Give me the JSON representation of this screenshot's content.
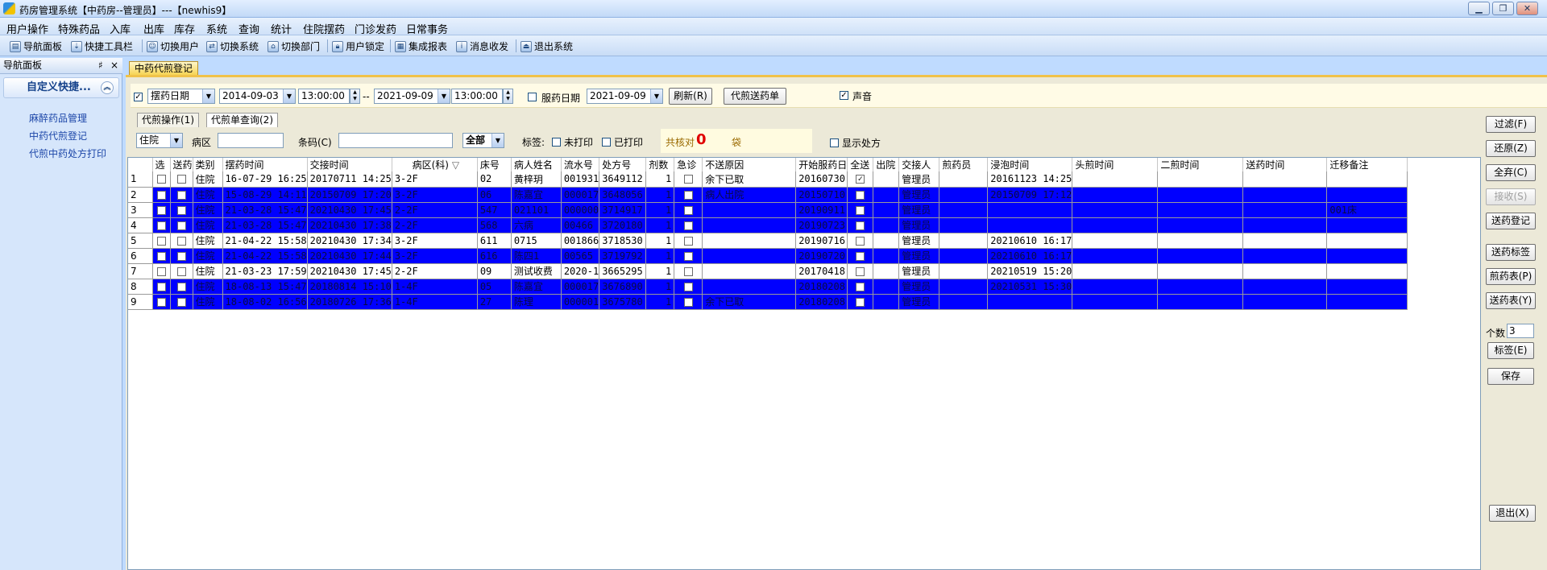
{
  "window": {
    "title": "药房管理系统【中药房--管理员】---【newhis9】"
  },
  "menu": [
    "用户操作",
    "特殊药品",
    "入库",
    "出库",
    "库存",
    "系统",
    "查询",
    "统计",
    "住院摆药",
    "门诊发药",
    "日常事务"
  ],
  "toolbar": [
    "导航面板",
    "快捷工具栏",
    "切换用户",
    "切换系统",
    "切换部门",
    "用户锁定",
    "集成报表",
    "消息收发",
    "退出系统"
  ],
  "nav": {
    "header": "导航面板",
    "pin": "♯",
    "close": "×",
    "group": "自定义快捷...",
    "items": [
      "麻醉药品管理",
      "中药代煎登记",
      "代煎中药处方打印"
    ]
  },
  "doc_tab": "中药代煎登记",
  "filter": {
    "date_type": "摆药日期",
    "start_date": "2014-09-03",
    "start_time": "13:00:00",
    "dash": "--",
    "end_date": "2021-09-09",
    "end_time": "13:00:00",
    "take_date_label": "服药日期",
    "take_date": "2021-09-09",
    "refresh_btn": "刷新(R)",
    "send_btn": "代煎送药单",
    "sound_label": "声音"
  },
  "subtabs": [
    "代煎操作(1)",
    "代煎单查询(2)"
  ],
  "query": {
    "type": "住院",
    "ward_label": "病区",
    "barcode_label": "条码(C)",
    "all": "全部",
    "tag_label": "标签:",
    "unprinted": "未打印",
    "printed": "已打印",
    "count_label": "共核对",
    "count_value": "0",
    "bag_label": "袋",
    "show_rx": "显示处方"
  },
  "grid": {
    "headers": [
      "选",
      "送药",
      "类别",
      "摆药时间",
      "交接时间",
      "病区(科)",
      "床号",
      "病人姓名",
      "流水号",
      "处方号",
      "剂数",
      "急诊",
      "不送原因",
      "开始服药日",
      "全送",
      "出院",
      "交接人",
      "煎药员",
      "浸泡时间",
      "头煎时间",
      "二煎时间",
      "送药时间",
      "迁移备注"
    ],
    "rows": [
      {
        "n": "1",
        "sel": false,
        "type": "住院",
        "disp": "16-07-29 16:25",
        "hand": "20170711 14:25",
        "ward": "3-2F",
        "bed": "02",
        "name": "黄梓玥",
        "serial": "001931",
        "rx": "3649112",
        "qty": "1",
        "reason": "余下已取",
        "start": "20160730",
        "allsend": true,
        "handler": "管理员",
        "soak": "20161123 14:25",
        "note": ""
      },
      {
        "n": "2",
        "sel": true,
        "type": "住院",
        "disp": "15-08-29 14:11",
        "hand": "20150709 17:20",
        "ward": "3-2F",
        "bed": "06",
        "name": "陈嘉宜",
        "serial": "000017",
        "rx": "3648056",
        "qty": "1",
        "reason": "病人出院",
        "start": "20150710",
        "allsend": false,
        "handler": "管理员",
        "soak": "20150709 17:12",
        "note": ""
      },
      {
        "n": "3",
        "sel": true,
        "type": "住院",
        "disp": "21-03-28 15:47",
        "hand": "20210430 17:45",
        "ward": "2-2F",
        "bed": "547",
        "name": "021101",
        "serial": "000000",
        "rx": "3714917",
        "qty": "1",
        "reason": "",
        "start": "20190911",
        "allsend": false,
        "handler": "管理员",
        "soak": "",
        "note": "001床"
      },
      {
        "n": "4",
        "sel": true,
        "type": "住院",
        "disp": "21-03-28 15:47",
        "hand": "20210430 17:38",
        "ward": "2-2F",
        "bed": "568",
        "name": "六病",
        "serial": "00466",
        "rx": "3720180",
        "qty": "1",
        "reason": "",
        "start": "20190723",
        "allsend": false,
        "handler": "管理员",
        "soak": "",
        "note": ""
      },
      {
        "n": "5",
        "sel": false,
        "type": "住院",
        "disp": "21-04-22 15:58",
        "hand": "20210430 17:34",
        "ward": "3-2F",
        "bed": "611",
        "name": "0715",
        "serial": "001866",
        "rx": "3718530",
        "qty": "1",
        "reason": "",
        "start": "20190716",
        "allsend": false,
        "handler": "管理员",
        "soak": "20210610 16:17",
        "note": ""
      },
      {
        "n": "6",
        "sel": true,
        "type": "住院",
        "disp": "21-04-22 15:58",
        "hand": "20210430 17:44",
        "ward": "3-2F",
        "bed": "616",
        "name": "陈四1",
        "serial": "00565",
        "rx": "3719792",
        "qty": "1",
        "reason": "",
        "start": "20190720",
        "allsend": false,
        "handler": "管理员",
        "soak": "20210610 16:17",
        "note": ""
      },
      {
        "n": "7",
        "sel": false,
        "type": "住院",
        "disp": "21-03-23 17:59",
        "hand": "20210430 17:45",
        "ward": "2-2F",
        "bed": "09",
        "name": "测试收费",
        "serial": "2020-1",
        "rx": "3665295",
        "qty": "1",
        "reason": "",
        "start": "20170418",
        "allsend": false,
        "handler": "管理员",
        "soak": "20210519 15:20",
        "note": ""
      },
      {
        "n": "8",
        "sel": true,
        "type": "住院",
        "disp": "18-08-13 15:47",
        "hand": "20180814 15:10",
        "ward": "1-4F",
        "bed": "05",
        "name": "陈嘉宜",
        "serial": "000017",
        "rx": "3676890",
        "qty": "1",
        "reason": "",
        "start": "20180208",
        "allsend": false,
        "handler": "管理员",
        "soak": "20210531 15:30",
        "note": ""
      },
      {
        "n": "9",
        "sel": true,
        "type": "住院",
        "disp": "18-08-02 16:56",
        "hand": "20180726 17:36",
        "ward": "1-4F",
        "bed": "27",
        "name": "陈理",
        "serial": "000001",
        "rx": "3675780",
        "qty": "1",
        "reason": "余下已取",
        "start": "20180208",
        "allsend": false,
        "handler": "管理员",
        "soak": "",
        "note": ""
      }
    ]
  },
  "right": {
    "buttons": [
      "过滤(F)",
      "还原(Z)",
      "全弃(C)",
      "接收(S)",
      "送药登记",
      "送药标签",
      "煎药表(P)",
      "送药表(Y)"
    ],
    "count_label": "个数",
    "count_value": "3",
    "label_btn": "标签(E)",
    "save_btn": "保存",
    "exit_btn": "退出(X)"
  }
}
